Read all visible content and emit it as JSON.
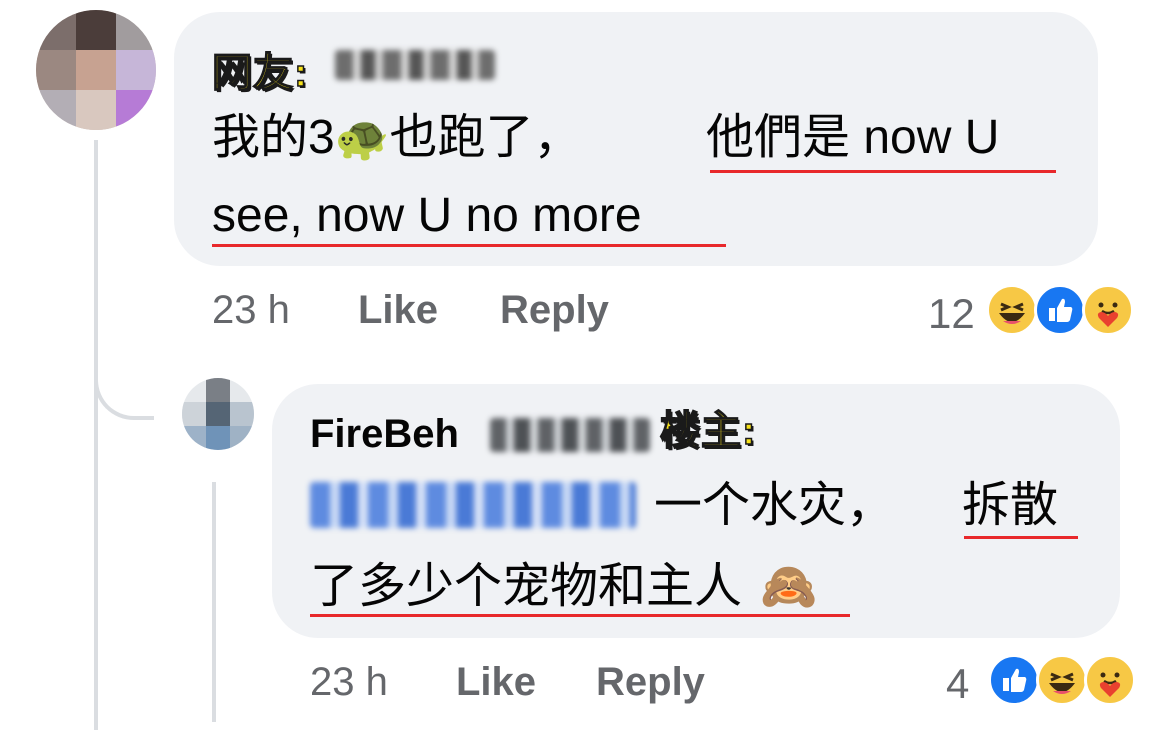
{
  "comment1": {
    "tag_label": "网友:",
    "text_line1": "我的3",
    "turtle_emoji": "🐢",
    "text_line1_after": "也跑了，",
    "underlined_line1": "他們是 now U",
    "text_line2": "see, now U no more",
    "time": "23 h",
    "like_label": "Like",
    "reply_label": "Reply",
    "reaction_count": "12",
    "reactions": [
      "haha-icon",
      "like-icon",
      "care-icon"
    ]
  },
  "comment2": {
    "author": "FireBeh",
    "tag_label": "楼主:",
    "text_line1": "一个水灾，",
    "underlined_line1": "拆散",
    "text_line2": "了多少个宠物和主人",
    "monkey_emoji": "🙈",
    "time": "23 h",
    "like_label": "Like",
    "reply_label": "Reply",
    "reaction_count": "4",
    "reactions": [
      "like-icon",
      "haha-icon",
      "care-icon"
    ]
  },
  "colors": {
    "bubble": "#f0f2f5",
    "meta": "#65676b",
    "underline": "#e8282b",
    "tag_yellow": "#f7e21b",
    "like_blue": "#1877f2"
  }
}
